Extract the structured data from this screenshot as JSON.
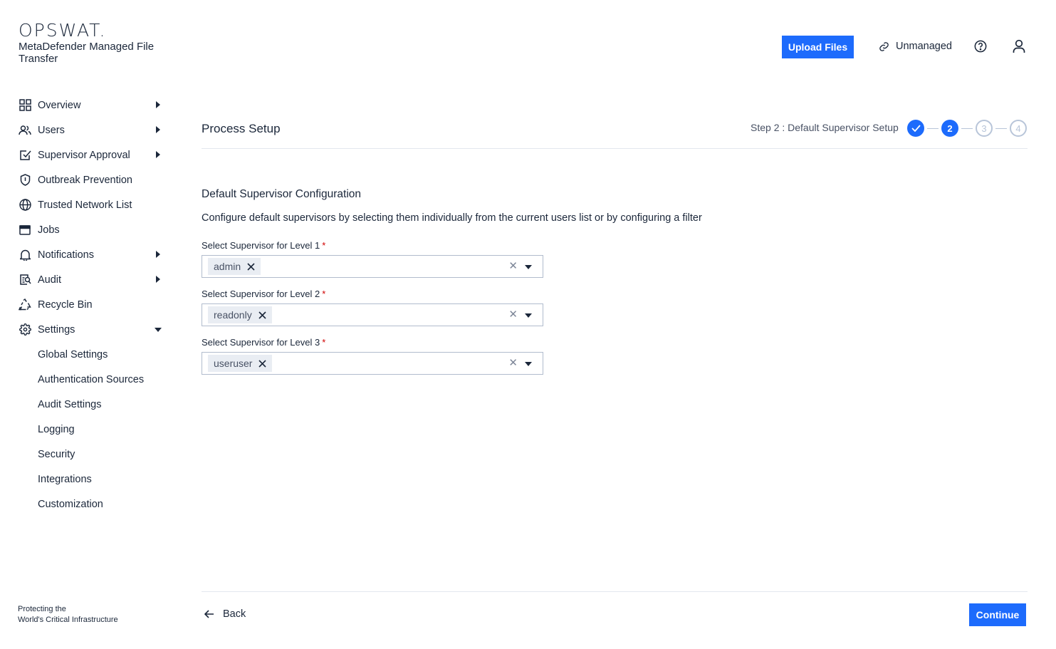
{
  "brand": {
    "logo_text": "OPSWAT.",
    "app_name": "MetaDefender Managed File Transfer",
    "tagline_line1": "Protecting the",
    "tagline_line2": "World's Critical Infrastructure"
  },
  "header": {
    "upload_label": "Upload Files",
    "unmanaged_label": "Unmanaged"
  },
  "sidebar": {
    "items": [
      {
        "label": "Overview",
        "icon": "grid-icon",
        "expandable": true
      },
      {
        "label": "Users",
        "icon": "users-icon",
        "expandable": true
      },
      {
        "label": "Supervisor Approval",
        "icon": "approval-icon",
        "expandable": true
      },
      {
        "label": "Outbreak Prevention",
        "icon": "shield-icon",
        "expandable": false
      },
      {
        "label": "Trusted Network List",
        "icon": "globe-icon",
        "expandable": false
      },
      {
        "label": "Jobs",
        "icon": "window-icon",
        "expandable": false
      },
      {
        "label": "Notifications",
        "icon": "bell-icon",
        "expandable": true
      },
      {
        "label": "Audit",
        "icon": "audit-icon",
        "expandable": true
      },
      {
        "label": "Recycle Bin",
        "icon": "recycle-icon",
        "expandable": false
      },
      {
        "label": "Settings",
        "icon": "gear-icon",
        "expandable": true,
        "expanded": true
      }
    ],
    "settings_children": [
      "Global Settings",
      "Authentication Sources",
      "Audit Settings",
      "Logging",
      "Security",
      "Integrations",
      "Customization"
    ]
  },
  "main": {
    "title": "Process Setup",
    "step_label": "Step 2 : Default Supervisor Setup",
    "steps": [
      "1",
      "2",
      "3",
      "4"
    ],
    "current_step": 2,
    "section_title": "Default Supervisor Configuration",
    "section_desc": "Configure default supervisors by selecting them individually from the current users list or by configuring a filter",
    "fields": [
      {
        "label": "Select Supervisor for Level 1",
        "required": "*",
        "value": "admin"
      },
      {
        "label": "Select Supervisor for Level 2",
        "required": "*",
        "value": "readonly"
      },
      {
        "label": "Select Supervisor for Level 3",
        "required": "*",
        "value": "useruser"
      }
    ],
    "back_label": "Back",
    "continue_label": "Continue"
  },
  "colors": {
    "primary": "#1d6bfc",
    "text": "#1b273a",
    "required": "#d00000",
    "chip_bg": "#e9edf3"
  }
}
